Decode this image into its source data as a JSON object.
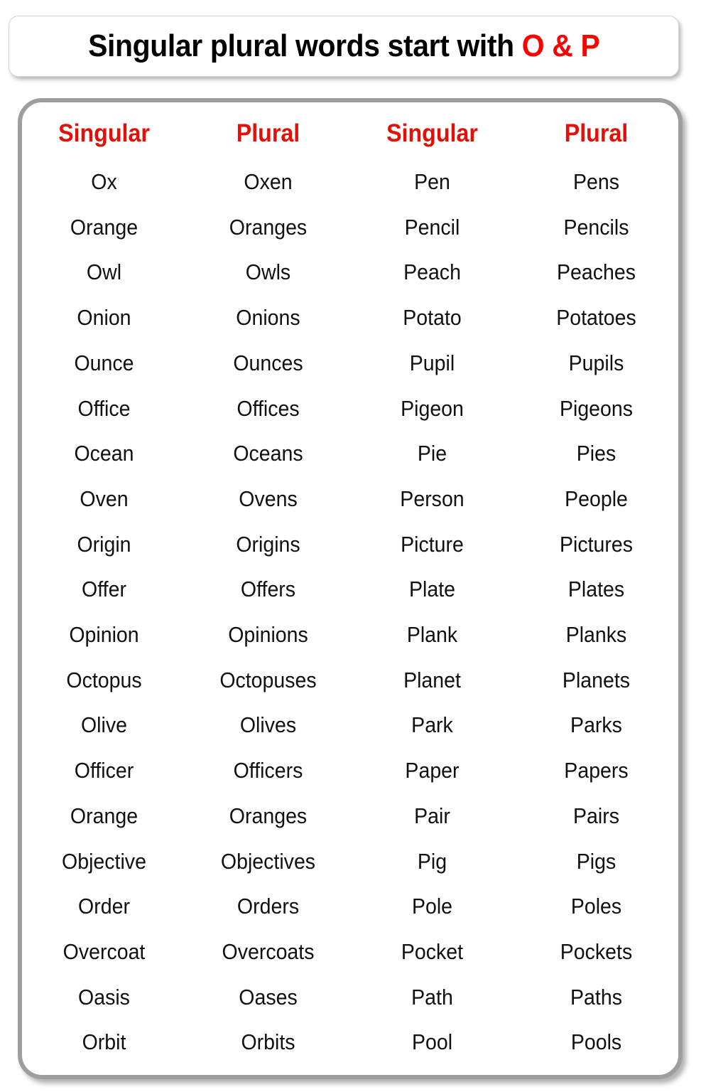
{
  "title": {
    "main_text": "Singular plural words start with ",
    "accent_text": "O & P",
    "accent_color": "#ff0000",
    "text_color": "#000000"
  },
  "table": {
    "header_color": "#e31007",
    "headers": [
      "Singular",
      "Plural",
      "Singular",
      "Plural"
    ],
    "rows": [
      [
        "Ox",
        "Oxen",
        "Pen",
        "Pens"
      ],
      [
        "Orange",
        "Oranges",
        "Pencil",
        "Pencils"
      ],
      [
        "Owl",
        "Owls",
        "Peach",
        "Peaches"
      ],
      [
        "Onion",
        "Onions",
        "Potato",
        "Potatoes"
      ],
      [
        "Ounce",
        "Ounces",
        "Pupil",
        "Pupils"
      ],
      [
        "Office",
        "Offices",
        "Pigeon",
        "Pigeons"
      ],
      [
        "Ocean",
        "Oceans",
        "Pie",
        "Pies"
      ],
      [
        "Oven",
        "Ovens",
        "Person",
        "People"
      ],
      [
        "Origin",
        "Origins",
        "Picture",
        "Pictures"
      ],
      [
        "Offer",
        "Offers",
        "Plate",
        "Plates"
      ],
      [
        "Opinion",
        "Opinions",
        "Plank",
        "Planks"
      ],
      [
        "Octopus",
        "Octopuses",
        "Planet",
        "Planets"
      ],
      [
        "Olive",
        "Olives",
        "Park",
        "Parks"
      ],
      [
        "Officer",
        "Officers",
        "Paper",
        "Papers"
      ],
      [
        "Orange",
        "Oranges",
        "Pair",
        "Pairs"
      ],
      [
        "Objective",
        "Objectives",
        "Pig",
        "Pigs"
      ],
      [
        "Order",
        "Orders",
        "Pole",
        "Poles"
      ],
      [
        "Overcoat",
        "Overcoats",
        "Pocket",
        "Pockets"
      ],
      [
        "Oasis",
        "Oases",
        "Path",
        "Paths"
      ],
      [
        "Orbit",
        "Orbits",
        "Pool",
        "Pools"
      ]
    ]
  }
}
